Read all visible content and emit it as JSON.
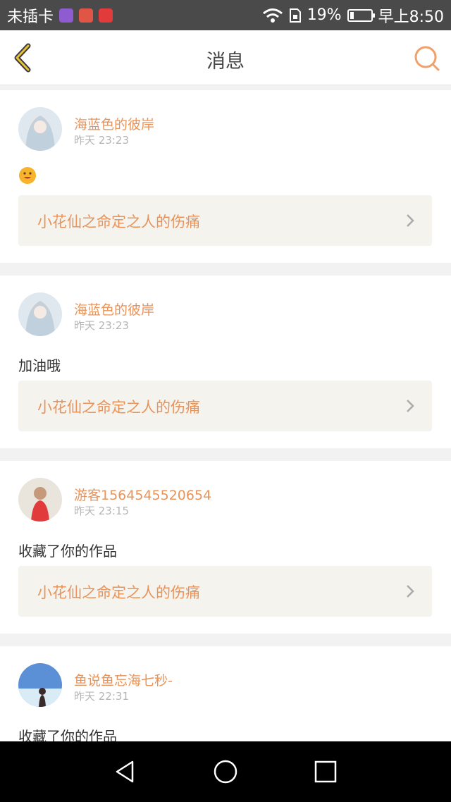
{
  "status_bar": {
    "carrier": "未插卡",
    "battery_text": "19%",
    "battery_level": 0.19,
    "time": "早上8:50"
  },
  "header": {
    "title": "消息"
  },
  "messages": [
    {
      "username": "海蓝色的彼岸",
      "time": "昨天 23:23",
      "content": "",
      "has_emoji": true,
      "work_title": "小花仙之命定之人的伤痛"
    },
    {
      "username": "海蓝色的彼岸",
      "time": "昨天 23:23",
      "content": "加油哦",
      "has_emoji": false,
      "work_title": "小花仙之命定之人的伤痛"
    },
    {
      "username": "游客1564545520654",
      "time": "昨天 23:15",
      "content": "收藏了你的作品",
      "has_emoji": false,
      "work_title": "小花仙之命定之人的伤痛"
    },
    {
      "username": "鱼说鱼忘海七秒-",
      "time": "昨天 22:31",
      "content": "收藏了你的作品",
      "has_emoji": false,
      "work_title": ""
    }
  ],
  "colors": {
    "accent": "#e8935a",
    "back_icon": "#d9a826",
    "link_bg": "#f5f3ee"
  }
}
